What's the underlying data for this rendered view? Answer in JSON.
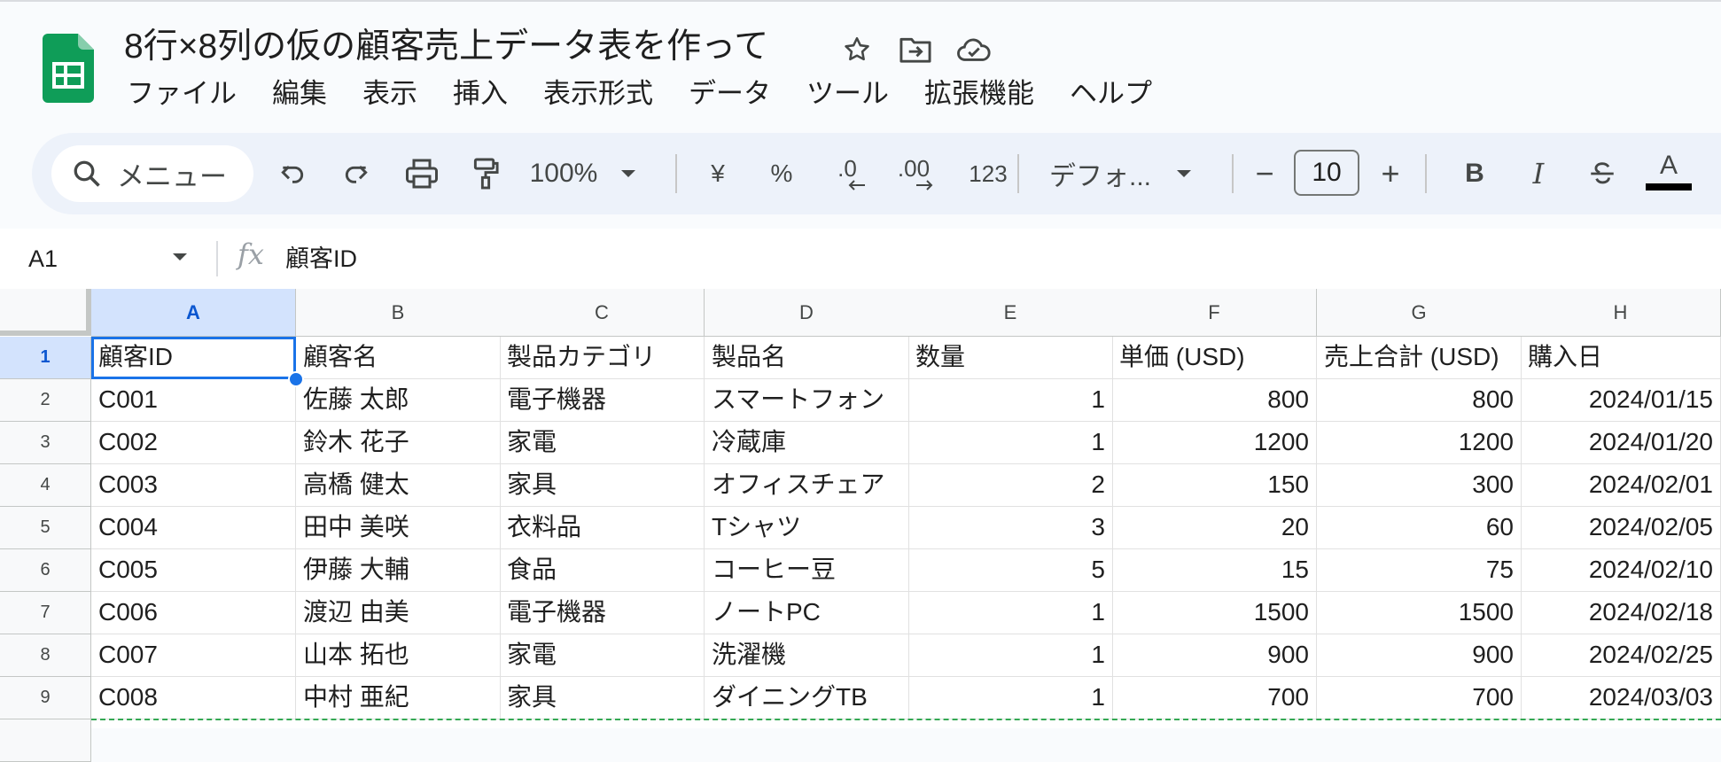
{
  "doc": {
    "title": "8行×8列の仮の顧客売上データ表を作って",
    "menu": [
      "ファイル",
      "編集",
      "表示",
      "挿入",
      "表示形式",
      "データ",
      "ツール",
      "拡張機能",
      "ヘルプ"
    ]
  },
  "toolbar": {
    "search_placeholder": "メニュー",
    "zoom": "100%",
    "currency": "¥",
    "percent": "%",
    "decrease_decimal": ".0",
    "increase_decimal": ".00",
    "number_format": "123",
    "font": "デフォ...",
    "font_size": "10",
    "minus": "−",
    "plus": "+",
    "bold": "B",
    "italic": "I",
    "text_color": "A"
  },
  "formula_bar": {
    "cell_ref": "A1",
    "value": "顧客ID"
  },
  "sheet": {
    "columns": [
      "A",
      "B",
      "C",
      "D",
      "E",
      "F",
      "G",
      "H"
    ],
    "row_numbers": [
      "1",
      "2",
      "3",
      "4",
      "5",
      "6",
      "7",
      "8",
      "9"
    ],
    "rows": [
      [
        "顧客ID",
        "顧客名",
        "製品カテゴリ",
        "製品名",
        "数量",
        "単価 (USD)",
        "売上合計 (USD)",
        "購入日"
      ],
      [
        "C001",
        "佐藤 太郎",
        "電子機器",
        "スマートフォン",
        "1",
        "800",
        "800",
        "2024/01/15"
      ],
      [
        "C002",
        "鈴木 花子",
        "家電",
        "冷蔵庫",
        "1",
        "1200",
        "1200",
        "2024/01/20"
      ],
      [
        "C003",
        "高橋 健太",
        "家具",
        "オフィスチェア",
        "2",
        "150",
        "300",
        "2024/02/01"
      ],
      [
        "C004",
        "田中 美咲",
        "衣料品",
        "Tシャツ",
        "3",
        "20",
        "60",
        "2024/02/05"
      ],
      [
        "C005",
        "伊藤 大輔",
        "食品",
        "コーヒー豆",
        "5",
        "15",
        "75",
        "2024/02/10"
      ],
      [
        "C006",
        "渡辺 由美",
        "電子機器",
        "ノートPC",
        "1",
        "1500",
        "1500",
        "2024/02/18"
      ],
      [
        "C007",
        "山本 拓也",
        "家電",
        "洗濯機",
        "1",
        "900",
        "900",
        "2024/02/25"
      ],
      [
        "C008",
        "中村 亜紀",
        "家具",
        "ダイニングTB",
        "1",
        "700",
        "700",
        "2024/03/03"
      ]
    ],
    "selected_cell": "A1"
  },
  "colors": {
    "accent": "#1a73e8",
    "sheets_green": "#0f9d58",
    "selection_header": "#d3e3fd"
  }
}
